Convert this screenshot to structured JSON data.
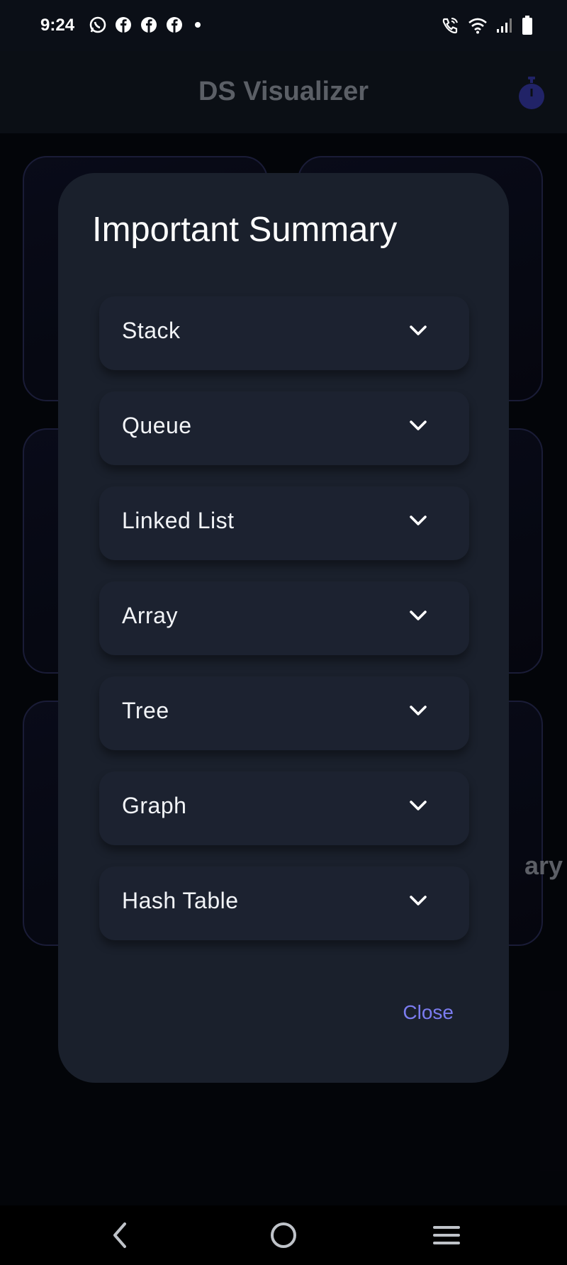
{
  "status_bar": {
    "time": "9:24",
    "left_icons": [
      "whatsapp-icon",
      "facebook-icon",
      "facebook-icon",
      "facebook-icon",
      "dot-icon"
    ],
    "right_icons": [
      "wifi-call-icon",
      "wifi-icon",
      "signal-icon",
      "battery-icon"
    ]
  },
  "app_bar": {
    "title": "DS Visualizer",
    "action_icon": "timer-icon"
  },
  "background": {
    "partial_card_label": "ary"
  },
  "dialog": {
    "title": "Important Summary",
    "items": [
      {
        "label": "Stack",
        "icon": "chevron-down-icon"
      },
      {
        "label": "Queue",
        "icon": "chevron-down-icon"
      },
      {
        "label": "Linked List",
        "icon": "chevron-down-icon"
      },
      {
        "label": "Array",
        "icon": "chevron-down-icon"
      },
      {
        "label": "Tree",
        "icon": "chevron-down-icon"
      },
      {
        "label": "Graph",
        "icon": "chevron-down-icon"
      },
      {
        "label": "Hash Table",
        "icon": "chevron-down-icon"
      }
    ],
    "close_label": "Close"
  },
  "nav_bar": {
    "buttons": [
      "back-icon",
      "home-icon",
      "recents-icon"
    ]
  },
  "colors": {
    "accent": "#7b7cf0",
    "dialog_bg": "#1a202c",
    "app_bg": "#05070d",
    "timer_icon": "#2d2f8a"
  }
}
